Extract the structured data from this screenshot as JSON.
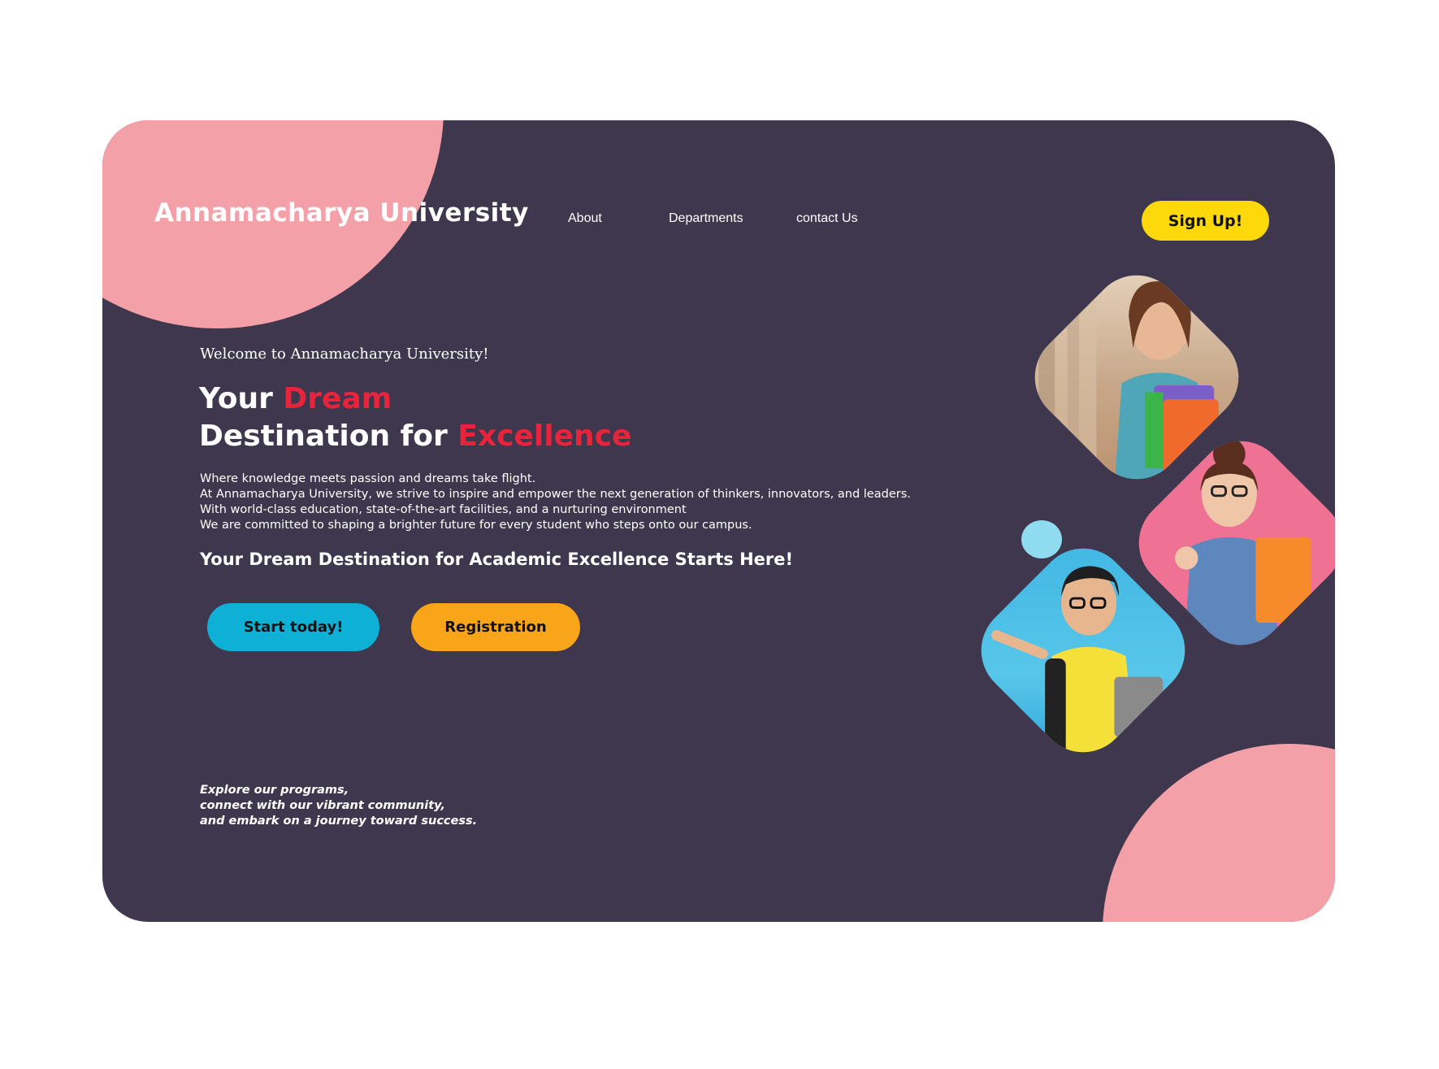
{
  "header": {
    "logo": "Annamacharya  University",
    "nav": [
      {
        "label": "About"
      },
      {
        "label": "Departments"
      },
      {
        "label": "contact Us"
      }
    ],
    "signup_label": "Sign Up!"
  },
  "hero": {
    "welcome": "Welcome to Annamacharya University!",
    "headline": {
      "line1_prefix": "Your ",
      "line1_accent": "Dream",
      "line2_prefix": "Destination for ",
      "line2_accent": "Excellence"
    },
    "body_lines": [
      "Where knowledge meets passion and dreams take flight.",
      "At Annamacharya University, we strive to inspire and empower the next generation of thinkers, innovators, and leaders.",
      "With world-class education, state-of-the-art facilities, and a nurturing environment",
      "We are committed to shaping a brighter future for every student who steps onto our campus."
    ],
    "tagline": "Your Dream Destination for Academic Excellence Starts Here!",
    "buttons": {
      "start_label": "Start today!",
      "register_label": "Registration"
    },
    "explore_lines": [
      "Explore our programs,",
      "connect with our vibrant community,",
      "and embark on a journey toward success."
    ]
  },
  "colors": {
    "background": "#3f374d",
    "blob": "#f4a0a8",
    "accent_red": "#e8243c",
    "signup_yellow": "#fdd80a",
    "start_blue": "#0eb0d6",
    "register_orange": "#f9a51a",
    "dot_cyan": "#8fdcf0"
  },
  "images": [
    {
      "name": "student-with-notebooks-photo"
    },
    {
      "name": "student-thumbs-up-photo"
    },
    {
      "name": "student-pointing-photo"
    }
  ]
}
